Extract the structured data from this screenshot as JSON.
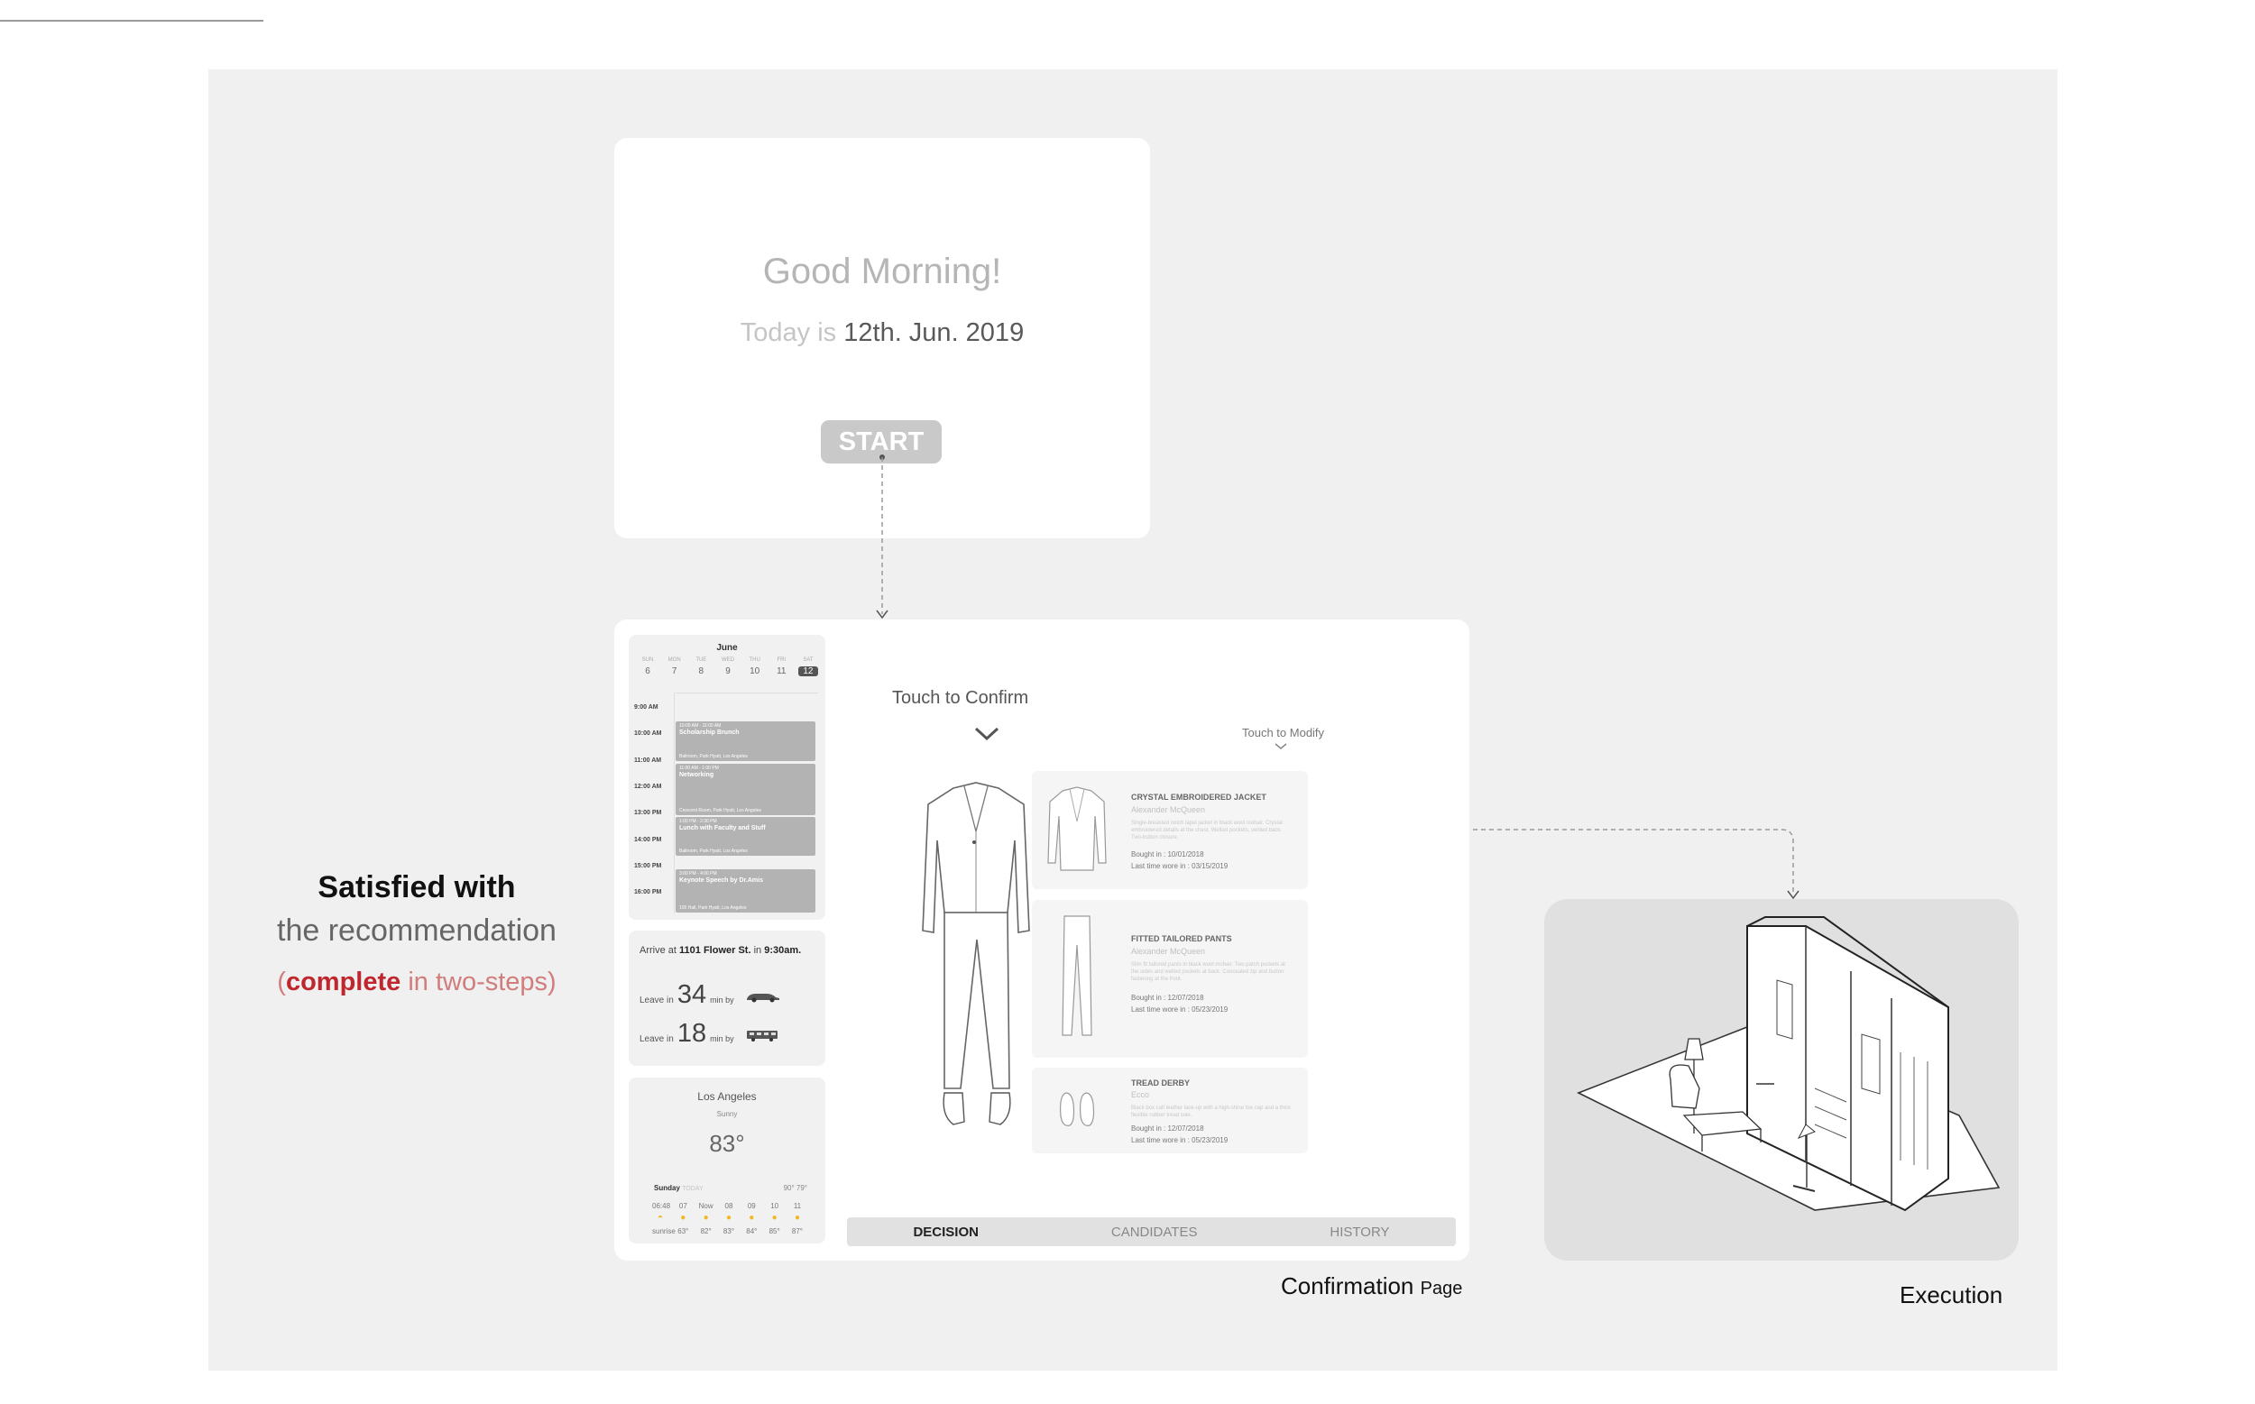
{
  "welcome": {
    "greeting": "Good Morning!",
    "today_label": "Today is",
    "date": "12th. Jun. 2019",
    "start_label": "START"
  },
  "calendar": {
    "month": "June",
    "weekday_labels": [
      "SUN",
      "MON",
      "TUE",
      "WED",
      "THU",
      "FRI",
      "SAT"
    ],
    "dates": [
      "6",
      "7",
      "8",
      "9",
      "10",
      "11",
      "12"
    ],
    "selected_date": "12",
    "hours": [
      "9:00 AM",
      "10:00 AM",
      "11:00 AM",
      "12:00 AM",
      "13:00 PM",
      "14:00 PM",
      "15:00 PM",
      "16:00 PM"
    ],
    "events": [
      {
        "time": "10:00 AM - 11:00 AM",
        "name": "Scholarship Brunch",
        "location": "Ballroom, Park Hyatt, Los Angeles"
      },
      {
        "time": "11:00 AM - 1:00 PM",
        "name": "Networking",
        "location": "Crescent Room, Park Hyatt, Los Angeles"
      },
      {
        "time": "1:00 PM - 2:30 PM",
        "name": "Lunch with Faculty and Stuff",
        "location": "Ballroom, Park Hyatt, Los Angeles"
      },
      {
        "time": "3:00 PM - 4:00 PM",
        "name": "Keynote Speech by Dr.Amis",
        "location": "100 Hall, Park Hyatt, Los Angeles"
      }
    ]
  },
  "commute": {
    "arrive_prefix": "Arrive at",
    "address": "1101 Flower St.",
    "in": "in",
    "time": "9:30am.",
    "leave_label": "Leave in",
    "unit": "min by",
    "car_minutes": "34",
    "transit_minutes": "18"
  },
  "weather": {
    "city": "Los Angeles",
    "condition": "Sunny",
    "temperature": "83°",
    "day": "Sunday",
    "day_tag": "TODAY",
    "high_low": "90°  79°",
    "hours": [
      "06:48",
      "07",
      "Now",
      "08",
      "09",
      "10",
      "11"
    ],
    "temps": [
      "sunrise",
      "63°",
      "82°",
      "83°",
      "84°",
      "85°",
      "87°"
    ]
  },
  "main": {
    "touch_to_confirm": "Touch to Confirm",
    "touch_to_modify": "Touch to Modify",
    "items": [
      {
        "name": "CRYSTAL EMBROIDERED JACKET",
        "brand": "Alexander McQueen",
        "desc": "Single-breasted notch lapel jacket in black wool mohair. Crystal embroidered details at the chest. Welted pockets, vented back. Two-button closure.",
        "bought": "Bought in : 10/01/2018",
        "worn": "Last time wore in : 03/15/2019"
      },
      {
        "name": "FITTED TAILORED PANTS",
        "brand": "Alexander McQueen",
        "desc": "Slim fit tailored pants in black wool mohair. Two patch pockets at the sides and welted pockets at back. Concealed zip and button fastening at the front.",
        "bought": "Bought in : 12/07/2018",
        "worn": "Last time wore in : 05/23/2019"
      },
      {
        "name": "TREAD DERBY",
        "brand": "Ecco",
        "desc": "Black box calf leather lace-up with a high-shine toe cap and a thick flexible rubber tread sole.",
        "bought": "Bought in : 12/07/2018",
        "worn": "Last time wore in : 05/23/2019"
      }
    ],
    "tabs": [
      "DECISION",
      "CANDIDATES",
      "HISTORY"
    ]
  },
  "captions": {
    "confirmation": "Confirmation",
    "page": "Page",
    "execution": "Execution"
  },
  "satisfied": {
    "line1": "Satisfied with",
    "line2": "the recommendation",
    "open_paren": "(",
    "complete": "complete",
    "rest": " in two-steps)"
  }
}
